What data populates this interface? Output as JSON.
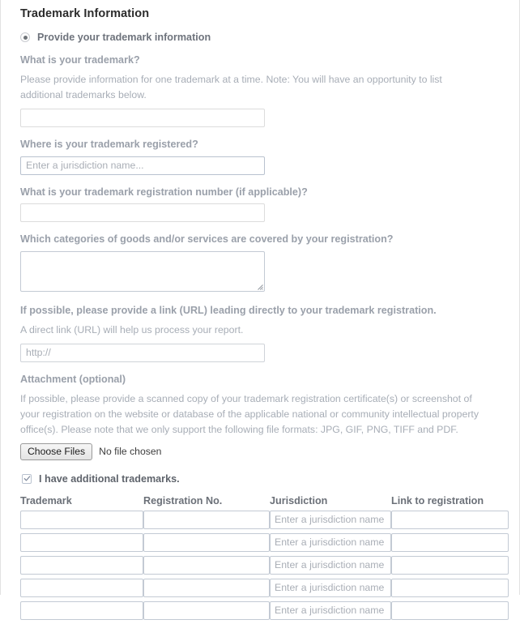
{
  "section": {
    "title": "Trademark Information"
  },
  "radio": {
    "label": "Provide your trademark information",
    "state": "selected"
  },
  "fields": {
    "trademark_name": {
      "label": "What is your trademark?",
      "help": "Please provide information for one trademark at a time. Note: You will have an opportunity to list additional trademarks below.",
      "value": "",
      "placeholder": ""
    },
    "jurisdiction": {
      "label": "Where is your trademark registered?",
      "value": "",
      "placeholder": "Enter a jurisdiction name..."
    },
    "registration_number": {
      "label": "What is your trademark registration number (if applicable)?",
      "value": "",
      "placeholder": ""
    },
    "categories": {
      "label": "Which categories of goods and/or services are covered by your registration?",
      "value": "",
      "placeholder": ""
    },
    "registration_url": {
      "label": "If possible, please provide a link (URL) leading directly to your trademark registration.",
      "help": "A direct link (URL) will help us process your report.",
      "value": "",
      "placeholder": "http://"
    },
    "attachment": {
      "label": "Attachment (optional)",
      "help": "If possible, please provide a scanned copy of your trademark registration certificate(s) or screenshot of your registration on the website or database of the applicable national or community intellectual property office(s). Please note that we only support the following file formats: JPG, GIF, PNG, TIFF and PDF.",
      "button_label": "Choose Files",
      "status": "No file chosen"
    }
  },
  "additional": {
    "checkbox_label": "I have additional trademarks.",
    "checkbox_state": "checked",
    "columns": [
      "Trademark",
      "Registration No.",
      "Jurisdiction",
      "Link to registration"
    ],
    "jurisdiction_placeholder": "Enter a jurisdiction name",
    "rows": [
      {
        "trademark": "",
        "registration_no": "",
        "jurisdiction": "",
        "link": ""
      },
      {
        "trademark": "",
        "registration_no": "",
        "jurisdiction": "",
        "link": ""
      },
      {
        "trademark": "",
        "registration_no": "",
        "jurisdiction": "",
        "link": ""
      },
      {
        "trademark": "",
        "registration_no": "",
        "jurisdiction": "",
        "link": ""
      },
      {
        "trademark": "",
        "registration_no": "",
        "jurisdiction": "",
        "link": ""
      }
    ]
  },
  "colors": {
    "heading": "#2b2b2b",
    "label": "#9aa0aa",
    "help": "#a7adb6",
    "input_border": "#c3cad4",
    "panel_border": "#e2e2e2"
  }
}
